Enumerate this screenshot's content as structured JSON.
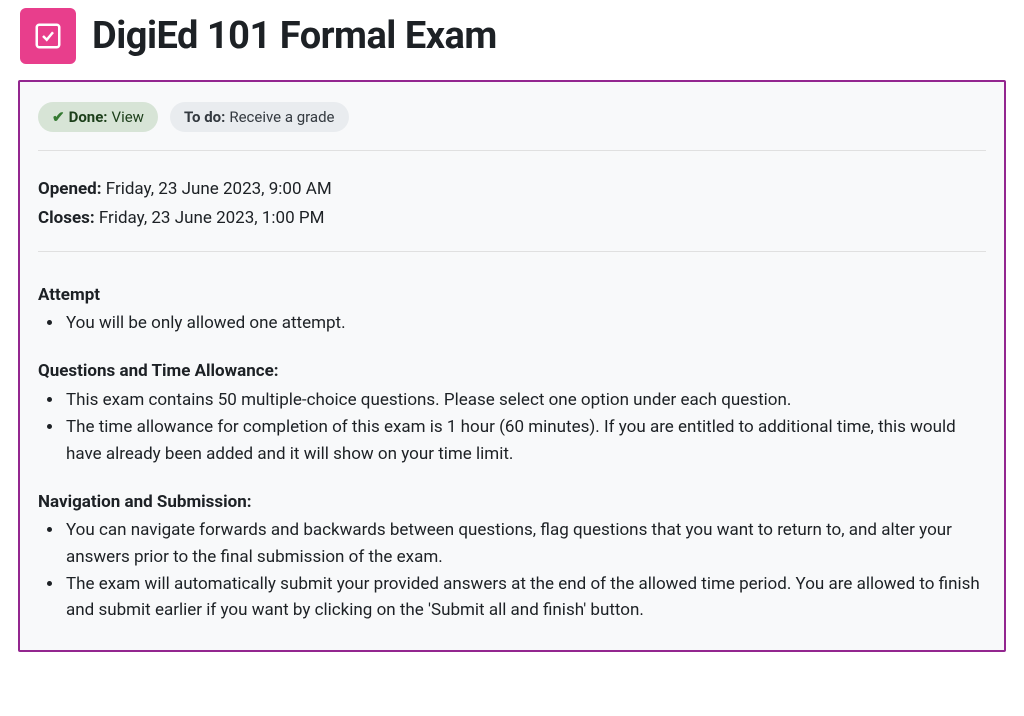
{
  "title": "DigiEd 101 Formal Exam",
  "status": {
    "done": {
      "label": "Done:",
      "text": "View"
    },
    "todo": {
      "label": "To do:",
      "text": "Receive a grade"
    }
  },
  "dates": {
    "opened_label": "Opened:",
    "opened_value": "Friday, 23 June 2023, 9:00 AM",
    "closes_label": "Closes:",
    "closes_value": "Friday, 23 June 2023, 1:00 PM"
  },
  "sections": {
    "attempt": {
      "title": "Attempt",
      "items": [
        "You will be only allowed one attempt."
      ]
    },
    "questions": {
      "title": "Questions and Time Allowance:",
      "items": [
        "This exam contains 50 multiple-choice questions.  Please select one option under each question.",
        "The time allowance for completion of this exam is 1 hour (60 minutes). If you are entitled to additional time, this would have already been added and it will show on your time limit."
      ]
    },
    "navigation": {
      "title": "Navigation and Submission:",
      "items": [
        "You can navigate forwards and backwards between questions, flag questions that you want to return to, and alter your answers prior to the final submission of the exam.",
        "The exam will automatically submit your provided answers at the end of the allowed time period.  You are allowed to finish and submit earlier if you want by clicking on the 'Submit all and finish' button."
      ]
    }
  }
}
